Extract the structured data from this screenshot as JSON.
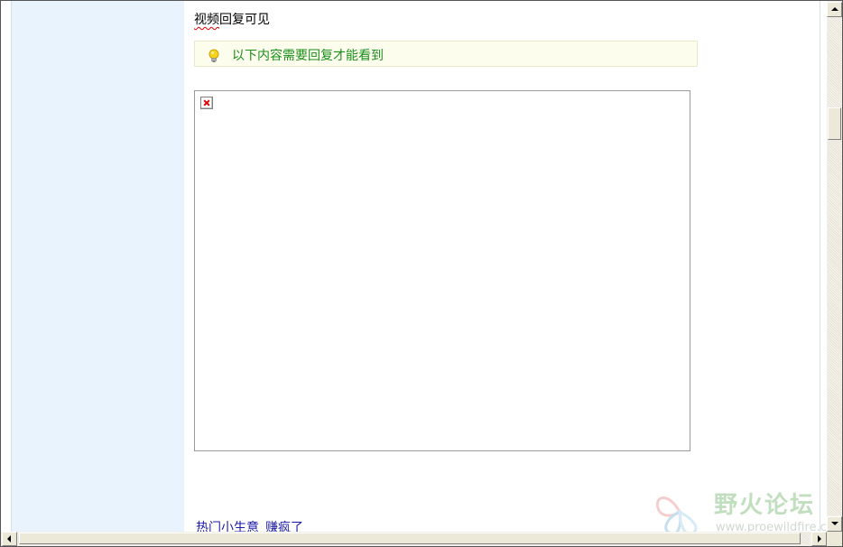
{
  "post": {
    "title_spellchecked": "视频",
    "title_rest": "回复可见"
  },
  "notice": {
    "icon": "lightbulb-icon",
    "text": "以下内容需要回复才能看到",
    "text_color": "#1b8e1b"
  },
  "media": {
    "icon": "broken-image-icon"
  },
  "ad_link": {
    "part1": "热门小生意",
    "part2": "赚疯了"
  },
  "watermark": {
    "title": "野火论坛",
    "url": "www.proewildfire.cn"
  },
  "colors": {
    "left_panel": "#e8f3fd",
    "link": "#1a1aa8",
    "spellcheck": "#e00000"
  }
}
